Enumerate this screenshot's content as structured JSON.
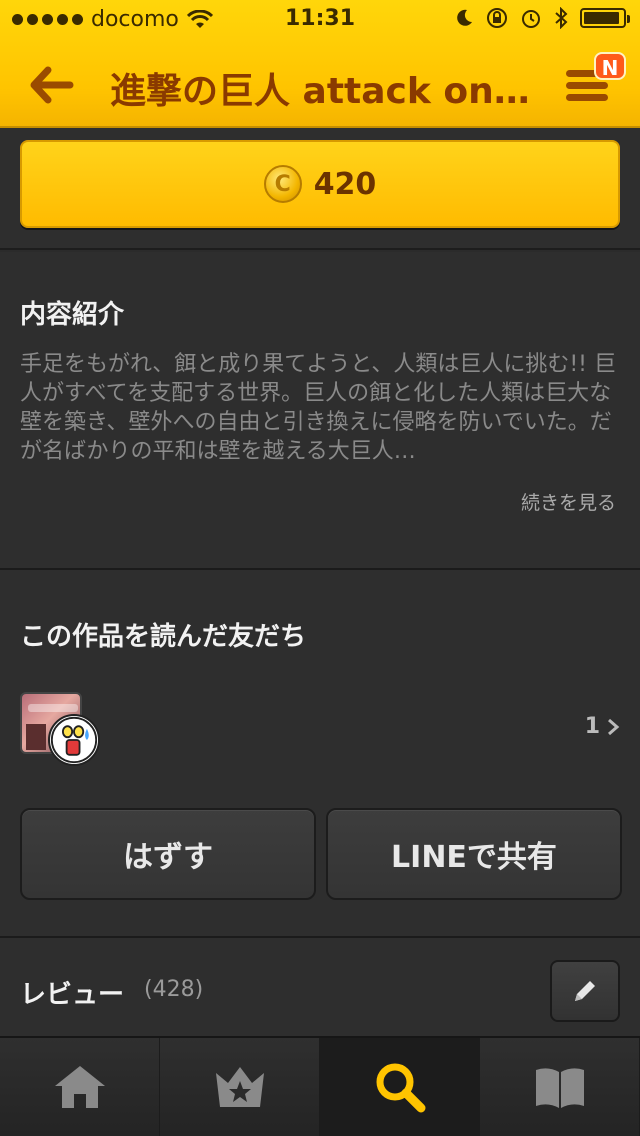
{
  "status_bar": {
    "carrier": "docomo",
    "time": "11:31",
    "battery_level": 0.92
  },
  "header": {
    "title": "進撃の巨人 attack on titan",
    "menu_badge": "N"
  },
  "purchase": {
    "coin_symbol": "C",
    "price": "420"
  },
  "description": {
    "title": "内容紹介",
    "text": "手足をもがれ、餌と成り果てようと、人類は巨人に挑む!! 巨人がすべてを支配する世界。巨人の餌と化した人類は巨大な壁を築き、壁外への自由と引き換えに侵略を防いでいた。だが名ばかりの平和は壁を越える大巨人…",
    "more_link": "続きを見る"
  },
  "friends": {
    "title": "この作品を読んだ友だち",
    "count": "1"
  },
  "actions": {
    "remove_label": "はずす",
    "share_label": "LINEで共有"
  },
  "reviews": {
    "title": "レビュー",
    "count": "(428)"
  },
  "tabs": [
    {
      "name": "home",
      "icon": "home-icon",
      "active": false
    },
    {
      "name": "ranking",
      "icon": "crown-icon",
      "active": false
    },
    {
      "name": "search",
      "icon": "search-icon",
      "active": true
    },
    {
      "name": "bookshelf",
      "icon": "book-icon",
      "active": false
    }
  ],
  "colors": {
    "header_yellow": "#ffc400",
    "title_brown": "#8a3a00",
    "search_active": "#ffc400",
    "background": "#2b2b2b"
  }
}
